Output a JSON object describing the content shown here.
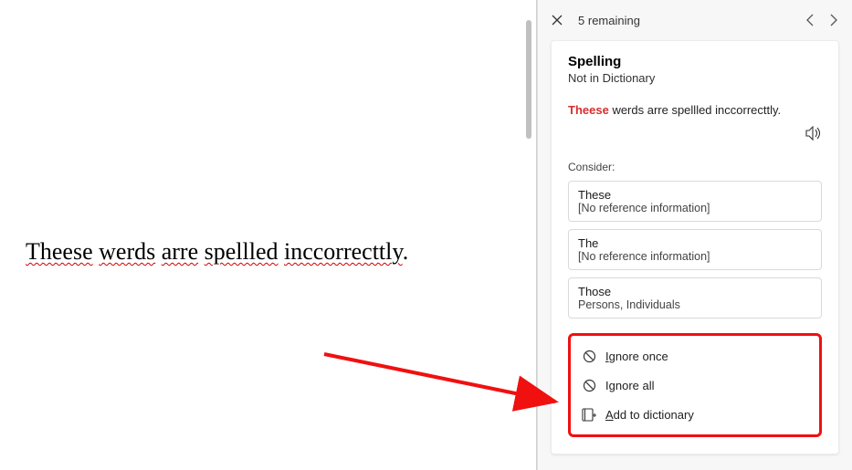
{
  "document": {
    "words": [
      "Theese",
      "werds",
      "arre",
      "spellled",
      "inccorrecttly"
    ],
    "trailing": "."
  },
  "panel": {
    "header": {
      "remaining_count": "5",
      "remaining_label": "remaining"
    },
    "spelling": {
      "title": "Spelling",
      "subtitle": "Not in Dictionary",
      "error_word": "Theese",
      "rest_of_sentence": "werds arre spellled inccorrecttly.",
      "consider_label": "Consider:",
      "suggestions": [
        {
          "word": "These",
          "info": "[No reference information]"
        },
        {
          "word": "The",
          "info": "[No reference information]"
        },
        {
          "word": "Those",
          "info": "Persons, Individuals"
        }
      ],
      "actions": {
        "ignore_once": "Ignore once",
        "ignore_all": "Ignore all",
        "add_to_dictionary": "Add to dictionary"
      }
    }
  }
}
